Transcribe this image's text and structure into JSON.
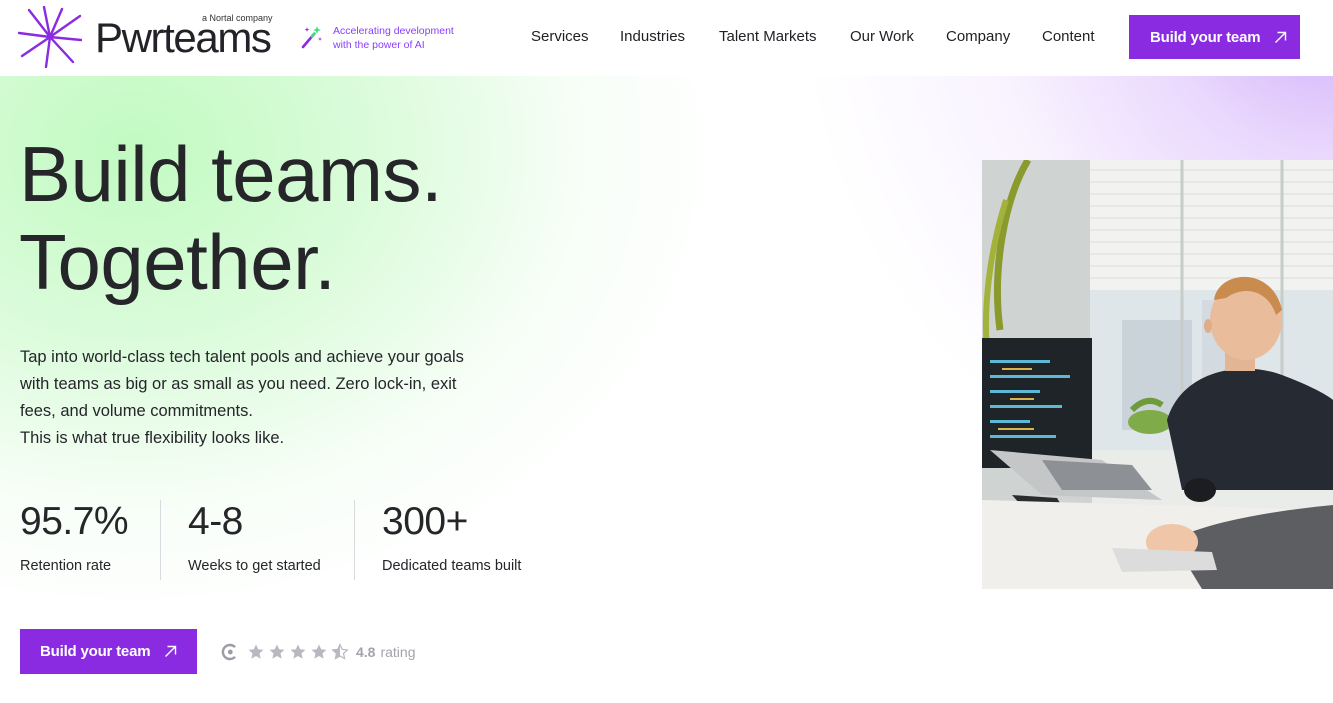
{
  "brand": {
    "name": "Pwrteams",
    "tagline": "a Nortal company",
    "ai_badge_lines": [
      "Accelerating development",
      "with the power of AI"
    ],
    "accent_color": "#8a2be2",
    "ai_text_color": "#8a3ffc"
  },
  "nav": {
    "items": [
      "Services",
      "Industries",
      "Talent Markets",
      "Our Work",
      "Company",
      "Content"
    ],
    "cta_label": "Build your team"
  },
  "hero": {
    "headline_lines": [
      "Build teams.",
      "Together."
    ],
    "description_lines": [
      "Tap into world-class tech talent pools and achieve your goals",
      "with teams as big or as small as you need. Zero lock-in, exit",
      "fees, and volume commitments.",
      "This is what true flexibility looks like."
    ],
    "stats": [
      {
        "value": "95.7%",
        "label": "Retention rate"
      },
      {
        "value": "4-8",
        "label": "Weeks to get started"
      },
      {
        "value": "300+",
        "label": "Dedicated teams built"
      }
    ],
    "cta_label": "Build your team",
    "rating": {
      "value": "4.8",
      "label": "rating",
      "stars": 4.5,
      "icons": [
        "clutch-icon",
        "star-icon"
      ]
    }
  }
}
